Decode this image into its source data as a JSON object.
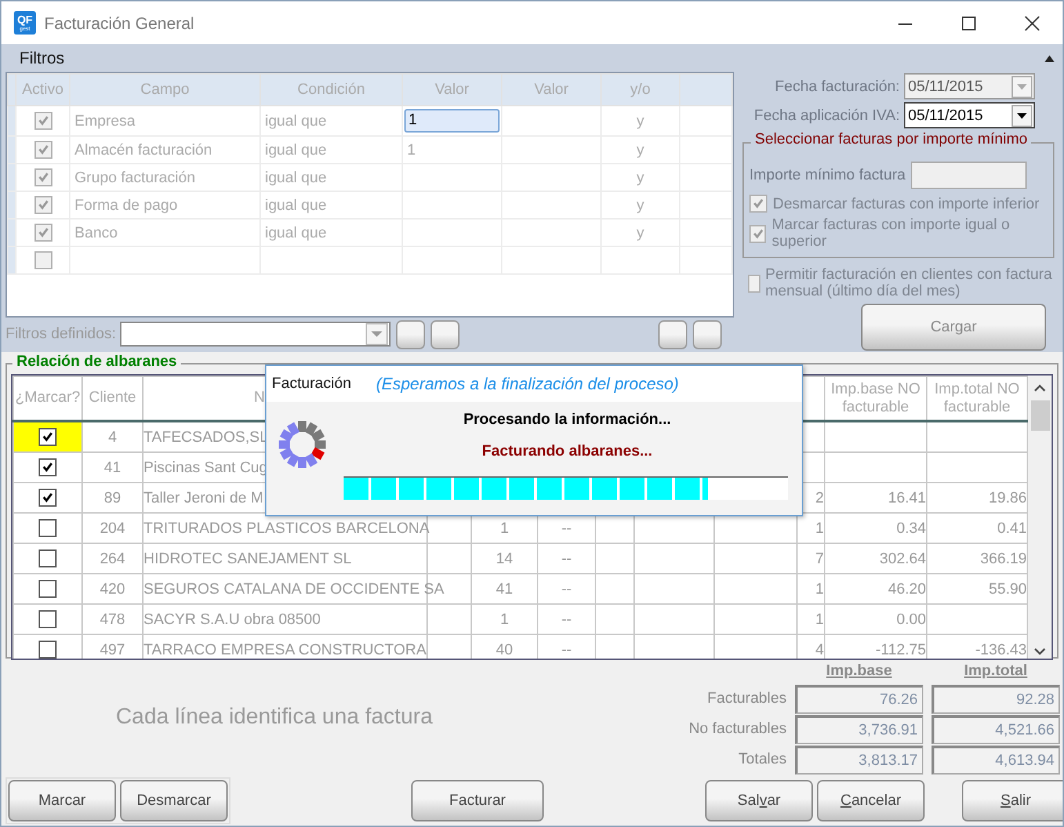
{
  "window": {
    "title": "Facturación General",
    "app_icon": [
      "QF",
      "gest"
    ]
  },
  "filters": {
    "title": "Filtros",
    "columns": [
      "Activo",
      "Campo",
      "Condición",
      "Valor",
      "Valor",
      "y/o"
    ],
    "rows": [
      {
        "active": true,
        "field": "Empresa",
        "condition": "igual que",
        "value": "1",
        "editing": true,
        "conjunction": "y"
      },
      {
        "active": true,
        "field": "Almacén facturación",
        "condition": "igual que",
        "value": "1",
        "editing": false,
        "conjunction": "y"
      },
      {
        "active": true,
        "field": "Grupo facturación",
        "condition": "igual que",
        "editing": false,
        "conjunction": "y"
      },
      {
        "active": true,
        "field": "Forma de pago",
        "condition": "igual que",
        "editing": false,
        "conjunction": "y"
      },
      {
        "active": true,
        "field": "Banco",
        "condition": "igual que",
        "editing": false,
        "conjunction": "y"
      },
      {
        "active": false,
        "editing": false
      }
    ],
    "defined_label": "Filtros definidos:"
  },
  "dates": [
    {
      "label": "Fecha facturación:",
      "value": "05/11/2015",
      "disabled": true
    },
    {
      "label": "Fecha aplicación IVA:",
      "value": "05/11/2015",
      "disabled": false
    }
  ],
  "min_amount": {
    "title": "Seleccionar facturas por importe mínimo",
    "field_label": "Importe mínimo factura",
    "options": [
      {
        "label": "Desmarcar facturas con importe inferior",
        "checked": true
      },
      {
        "label": "Marcar facturas con importe igual o superior",
        "checked": true
      }
    ]
  },
  "monthly": {
    "label": "Permitir facturación en clientes con factura mensual (último día del mes)",
    "checked": false
  },
  "load_button": "Cargar",
  "albaranes": {
    "title": "Relación de albaranes",
    "mark_column": "¿Marcar?",
    "columns": [
      "Cliente",
      "N",
      null,
      null,
      null,
      null,
      null,
      null,
      null,
      "Imp.base NO facturable",
      "Imp.total NO facturable"
    ],
    "rows": [
      {
        "marked": true,
        "selected": true,
        "cells": [
          "4",
          "TAFECSADOS,SL",
          null,
          null,
          null,
          null,
          null,
          null,
          null,
          null,
          null
        ]
      },
      {
        "marked": true,
        "selected": false,
        "cells": [
          "41",
          "Piscinas Sant Cug",
          null,
          null,
          null,
          null,
          null,
          null,
          null,
          null,
          null
        ]
      },
      {
        "marked": true,
        "selected": false,
        "cells": [
          "89",
          "Taller Jeroni de M",
          null,
          null,
          null,
          null,
          null,
          null,
          "2",
          "16.41",
          "19.86"
        ]
      },
      {
        "marked": false,
        "selected": false,
        "cells": [
          "204",
          "TRITURADOS PLASTICOS BARCELONA",
          null,
          "1",
          "--",
          null,
          null,
          null,
          "1",
          "0.34",
          "0.41"
        ]
      },
      {
        "marked": false,
        "selected": false,
        "cells": [
          "264",
          "HIDROTEC SANEJAMENT SL",
          null,
          "14",
          "--",
          null,
          null,
          null,
          "7",
          "302.64",
          "366.19"
        ]
      },
      {
        "marked": false,
        "selected": false,
        "cells": [
          "420",
          "SEGUROS CATALANA DE OCCIDENTE SA",
          null,
          "41",
          "--",
          null,
          null,
          null,
          "1",
          "46.20",
          "55.90"
        ]
      },
      {
        "marked": false,
        "selected": false,
        "cells": [
          "478",
          "SACYR S.A.U  obra 08500",
          null,
          "1",
          "--",
          null,
          null,
          null,
          "1",
          "0.00",
          null
        ]
      },
      {
        "marked": false,
        "selected": false,
        "cells": [
          "497",
          "TARRACO EMPRESA CONSTRUCTORA",
          null,
          "40",
          "--",
          null,
          null,
          null,
          "4",
          "-112.75",
          "-136.43"
        ]
      }
    ]
  },
  "hint": "Cada línea identifica una factura",
  "totals": {
    "columns": [
      "Imp.base",
      "Imp.total"
    ],
    "rows": [
      {
        "label": "Facturables",
        "values": [
          "76.26",
          "92.28"
        ]
      },
      {
        "label": "No facturables",
        "values": [
          "3,736.91",
          "4,521.66"
        ]
      },
      {
        "label": "Totales",
        "values": [
          "3,813.17",
          "4,613.94"
        ]
      }
    ]
  },
  "button_groups": [
    [
      {
        "pre": "Marcar"
      },
      {
        "pre": "Desmarcar"
      }
    ],
    [
      {
        "pre": "Facturar"
      }
    ],
    [
      {
        "pre": "Sal",
        "key": "v",
        "post": "ar"
      },
      {
        "key": "C",
        "post": "ancelar"
      }
    ],
    [
      {
        "key": "S",
        "post": "alir"
      }
    ]
  ],
  "dialog": {
    "title": "Facturación",
    "subtitle": "(Esperamos a la finalización del proceso)",
    "message": "Procesando la información...",
    "status": "Facturando albaranes...",
    "level": 0.82
  }
}
